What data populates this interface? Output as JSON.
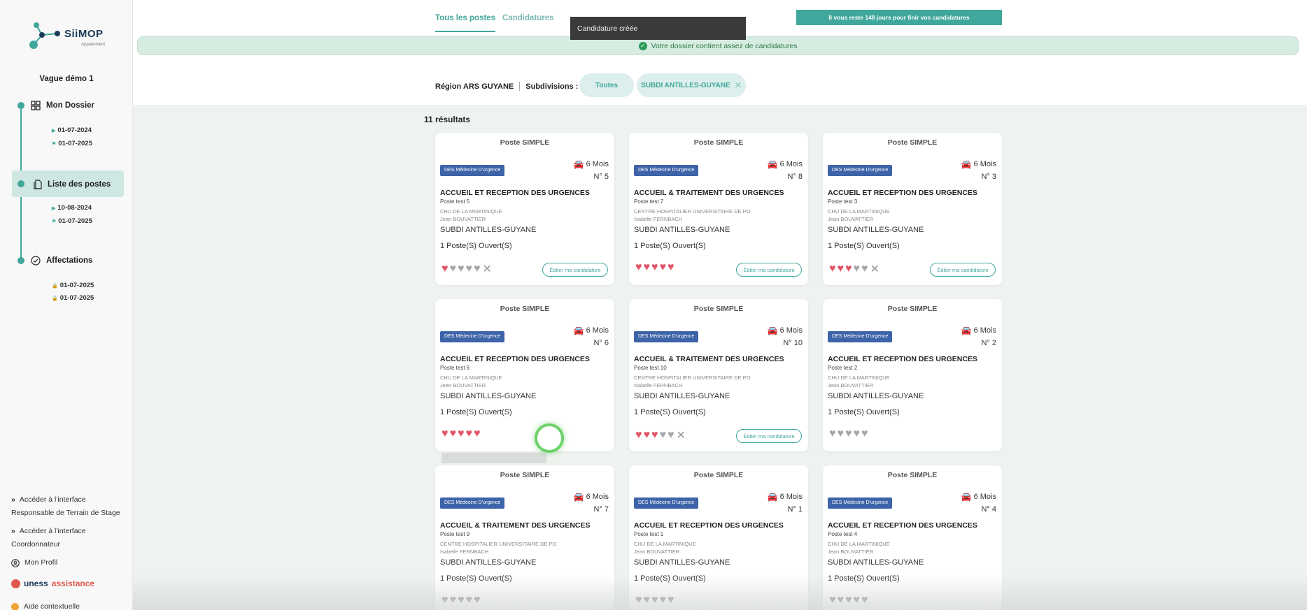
{
  "app": {
    "name": "SiiMOP",
    "subtitle": "Appariement",
    "vague": "Vague démo 1"
  },
  "sidebar": {
    "steps": [
      {
        "label": "Mon Dossier",
        "dates": [
          "01-07-2024",
          "01-07-2025"
        ],
        "icons": [
          "play-icon",
          "flag-icon"
        ]
      },
      {
        "label": "Liste des postes",
        "dates": [
          "10-08-2024",
          "01-07-2025"
        ],
        "icons": [
          "play-icon",
          "flag-icon"
        ],
        "active": true
      },
      {
        "label": "Affectations",
        "dates": [
          "01-07-2025",
          "01-07-2025"
        ],
        "icons": [
          "lock-icon",
          "lock-icon"
        ]
      }
    ],
    "footer": {
      "link1_line1": "Accéder à l'interface",
      "link1_line2": "Responsable de Terrain de Stage",
      "link2_line1": "Accéder à l'interface",
      "link2_line2": "Coordonnateur",
      "profile": "Mon Profil",
      "uness_a": "uness",
      "uness_b": "assistance",
      "aide": "Aide contextuelle"
    }
  },
  "header": {
    "tabs": [
      "Tous les postes",
      "Candidatures"
    ],
    "days_left": "Il vous reste 148 jours pour finir vos candidatures",
    "toast": "Candidature créée",
    "banner": "Votre dossier contient assez de candidatures"
  },
  "filters": {
    "region": "Région ARS GUYANE",
    "subdivisions_label": "Subdivisions :",
    "chip_all": "Toutes",
    "chip_sub": "SUBDI ANTILLES-GUYANE"
  },
  "results_label": "11 résultats",
  "cards": [
    {
      "type": "Poste SIMPLE",
      "duration": "6 Mois",
      "specialty": "DES Médecine D'urgence",
      "number": "N° 5",
      "title": "ACCUEIL ET RECEPTION DES URGENCES",
      "subtitle": "Poste test 5",
      "etablissement": "CHU DE LA MARTINIQUE",
      "contact": "Jean BOUVATTIER",
      "subdivision": "SUBDI ANTILLES-GUYANE",
      "open": "1 Poste(S) Ouvert(S)",
      "rating": 1,
      "edit": "Éditer ma candidature"
    },
    {
      "type": "Poste SIMPLE",
      "duration": "6 Mois",
      "specialty": "DES Médecine D'urgence",
      "number": "N° 8",
      "title": "ACCUEIL & TRAITEMENT DES URGENCES",
      "subtitle": "Poste test 7",
      "etablissement": "CENTRE HOSPITALIER UNIVERSITAIRE DE PO",
      "contact": "Isabelle FERNBACH",
      "subdivision": "SUBDI ANTILLES-GUYANE",
      "open": "1 Poste(S) Ouvert(S)",
      "rating": 5,
      "edit": "Éditer ma candidature"
    },
    {
      "type": "Poste SIMPLE",
      "duration": "6 Mois",
      "specialty": "DES Médecine D'urgence",
      "number": "N° 3",
      "title": "ACCUEIL ET RECEPTION DES URGENCES",
      "subtitle": "Poste test 3",
      "etablissement": "CHU DE LA MARTINIQUE",
      "contact": "Jean BOUVATTIER",
      "subdivision": "SUBDI ANTILLES-GUYANE",
      "open": "1 Poste(S) Ouvert(S)",
      "rating": 3,
      "edit": "Éditer ma candidature"
    },
    {
      "type": "Poste SIMPLE",
      "duration": "6 Mois",
      "specialty": "DES Médecine D'urgence",
      "number": "N° 6",
      "title": "ACCUEIL ET RECEPTION DES URGENCES",
      "subtitle": "Poste test 6",
      "etablissement": "CHU DE LA MARTINIQUE",
      "contact": "Jean BOUVATTIER",
      "subdivision": "SUBDI ANTILLES-GUYANE",
      "open": "1 Poste(S) Ouvert(S)",
      "rating": 5,
      "edit": ""
    },
    {
      "type": "Poste SIMPLE",
      "duration": "6 Mois",
      "specialty": "DES Médecine D'urgence",
      "number": "N° 10",
      "title": "ACCUEIL & TRAITEMENT DES URGENCES",
      "subtitle": "Poste test 10",
      "etablissement": "CENTRE HOSPITALIER UNIVERSITAIRE DE PO",
      "contact": "Isabelle FERNBACH",
      "subdivision": "SUBDI ANTILLES-GUYANE",
      "open": "1 Poste(S) Ouvert(S)",
      "rating": 3,
      "edit": "Éditer ma candidature"
    },
    {
      "type": "Poste SIMPLE",
      "duration": "6 Mois",
      "specialty": "DES Médecine D'urgence",
      "number": "N° 2",
      "title": "ACCUEIL ET RECEPTION DES URGENCES",
      "subtitle": "Poste test 2",
      "etablissement": "CHU DE LA MARTINIQUE",
      "contact": "Jean BOUVATTIER",
      "subdivision": "SUBDI ANTILLES-GUYANE",
      "open": "1 Poste(S) Ouvert(S)",
      "rating": 0,
      "edit": ""
    },
    {
      "type": "Poste SIMPLE",
      "duration": "6 Mois",
      "specialty": "DES Médecine D'urgence",
      "number": "N° 7",
      "title": "ACCUEIL & TRAITEMENT DES URGENCES",
      "subtitle": "Poste test 9",
      "etablissement": "CENTRE HOSPITALIER UNIVERSITAIRE DE PO",
      "contact": "Isabelle FERNBACH",
      "subdivision": "SUBDI ANTILLES-GUYANE",
      "open": "1 Poste(S) Ouvert(S)",
      "rating": 0,
      "edit": ""
    },
    {
      "type": "Poste SIMPLE",
      "duration": "6 Mois",
      "specialty": "DES Médecine D'urgence",
      "number": "N° 1",
      "title": "ACCUEIL ET RECEPTION DES URGENCES",
      "subtitle": "Poste test 1",
      "etablissement": "CHU DE LA MARTINIQUE",
      "contact": "Jean BOUVATTIER",
      "subdivision": "SUBDI ANTILLES-GUYANE",
      "open": "1 Poste(S) Ouvert(S)",
      "rating": 0,
      "edit": ""
    },
    {
      "type": "Poste SIMPLE",
      "duration": "6 Mois",
      "specialty": "DES Médecine D'urgence",
      "number": "N° 4",
      "title": "ACCUEIL ET RECEPTION DES URGENCES",
      "subtitle": "Poste test 4",
      "etablissement": "CHU DE LA MARTINIQUE",
      "contact": "Jean BOUVATTIER",
      "subdivision": "SUBDI ANTILLES-GUYANE",
      "open": "1 Poste(S) Ouvert(S)",
      "rating": 0,
      "edit": ""
    }
  ],
  "colors": {
    "accent": "#3fa79b",
    "badge": "#3d63a8",
    "heart_on": "#e05566",
    "heart_off": "#a7a7a7",
    "banner_bg": "#d7ece1"
  }
}
